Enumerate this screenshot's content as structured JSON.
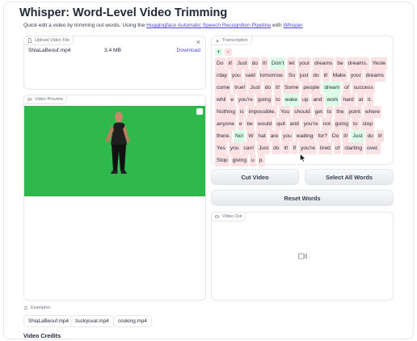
{
  "header": {
    "title": "Whisper: Word-Level Video Trimming",
    "desc_prefix": "Quick edit a video by trimming out words. Using the ",
    "desc_link1": "Huggingface Automatic Speech Recognition Pipeline",
    "desc_mid": " with ",
    "desc_link2": "Whisper"
  },
  "upload": {
    "label": "Upload Video File",
    "filename": "ShiaLaBeouf.mp4",
    "size": "3.4 MB",
    "download": "Download"
  },
  "preview": {
    "label": "Video Preview"
  },
  "transcription": {
    "label": "Transcription",
    "legend_plus": "+",
    "legend_minus": "-",
    "tokens": [
      {
        "t": "Do",
        "g": false
      },
      {
        "t": "it!",
        "g": false
      },
      {
        "t": "Just",
        "g": false
      },
      {
        "t": "do",
        "g": false
      },
      {
        "t": "it!",
        "g": false
      },
      {
        "t": "Don't",
        "g": true
      },
      {
        "t": "let",
        "g": false
      },
      {
        "t": "your",
        "g": false
      },
      {
        "t": "dreams",
        "g": false
      },
      {
        "t": "be",
        "g": false
      },
      {
        "t": "dreams.",
        "g": false
      },
      {
        "t": "Yeste",
        "g": false
      },
      {
        "t": "rday",
        "g": false
      },
      {
        "t": "you",
        "g": false
      },
      {
        "t": "said",
        "g": false
      },
      {
        "t": "tomorrow.",
        "g": false
      },
      {
        "t": "So",
        "g": false
      },
      {
        "t": "just",
        "g": false
      },
      {
        "t": "do",
        "g": false
      },
      {
        "t": "it!",
        "g": false
      },
      {
        "t": "Make",
        "g": false
      },
      {
        "t": "your",
        "g": false
      },
      {
        "t": "dreams",
        "g": false
      },
      {
        "t": "come",
        "g": false
      },
      {
        "t": "true!",
        "g": false
      },
      {
        "t": "Just",
        "g": false
      },
      {
        "t": "do",
        "g": false
      },
      {
        "t": "it!",
        "g": false
      },
      {
        "t": "Some",
        "g": false
      },
      {
        "t": "people",
        "g": false
      },
      {
        "t": "dream",
        "g": true
      },
      {
        "t": "of",
        "g": false
      },
      {
        "t": "success",
        "g": false
      },
      {
        "t": "whil",
        "g": false
      },
      {
        "t": "e",
        "g": false
      },
      {
        "t": "you're",
        "g": false
      },
      {
        "t": "going",
        "g": false
      },
      {
        "t": "to",
        "g": false
      },
      {
        "t": "wake",
        "g": true
      },
      {
        "t": "up",
        "g": false
      },
      {
        "t": "and",
        "g": false
      },
      {
        "t": "work",
        "g": true
      },
      {
        "t": "hard",
        "g": false
      },
      {
        "t": "at",
        "g": false
      },
      {
        "t": "it.",
        "g": false
      },
      {
        "t": "Nothing",
        "g": false
      },
      {
        "t": "is",
        "g": false
      },
      {
        "t": "impossible.",
        "g": false
      },
      {
        "t": "You",
        "g": false
      },
      {
        "t": "should",
        "g": false
      },
      {
        "t": "get",
        "g": false
      },
      {
        "t": "to",
        "g": false
      },
      {
        "t": "the",
        "g": false
      },
      {
        "t": "point",
        "g": false
      },
      {
        "t": "where",
        "g": false
      },
      {
        "t": "anyone",
        "g": false
      },
      {
        "t": "e",
        "g": false
      },
      {
        "t": "be",
        "g": false
      },
      {
        "t": "would",
        "g": false
      },
      {
        "t": "quit",
        "g": false
      },
      {
        "t": "and",
        "g": false
      },
      {
        "t": "you're",
        "g": false
      },
      {
        "t": "not",
        "g": false
      },
      {
        "t": "going",
        "g": false
      },
      {
        "t": "to",
        "g": false
      },
      {
        "t": "stop",
        "g": false
      },
      {
        "t": "there.",
        "g": false
      },
      {
        "t": "No!",
        "g": true
      },
      {
        "t": "W",
        "g": false
      },
      {
        "t": "hat",
        "g": false
      },
      {
        "t": "are",
        "g": false
      },
      {
        "t": "you",
        "g": false
      },
      {
        "t": "waiting",
        "g": false
      },
      {
        "t": "for?",
        "g": false
      },
      {
        "t": "Do",
        "g": false
      },
      {
        "t": "it!",
        "g": false
      },
      {
        "t": "Just",
        "g": true
      },
      {
        "t": "do",
        "g": false
      },
      {
        "t": "it!",
        "g": false
      },
      {
        "t": "Yes",
        "g": false
      },
      {
        "t": "you",
        "g": false
      },
      {
        "t": "can!",
        "g": false
      },
      {
        "t": "Just",
        "g": false
      },
      {
        "t": "do",
        "g": false
      },
      {
        "t": "it!",
        "g": false
      },
      {
        "t": "If",
        "g": false
      },
      {
        "t": "you're",
        "g": false
      },
      {
        "t": "tired",
        "g": false
      },
      {
        "t": "of",
        "g": false
      },
      {
        "t": "starting",
        "g": false
      },
      {
        "t": "over,",
        "g": false
      },
      {
        "t": "Stop",
        "g": false
      },
      {
        "t": "giving",
        "g": false
      },
      {
        "t": "u",
        "g": false
      },
      {
        "t": "p.",
        "g": false
      }
    ]
  },
  "buttons": {
    "cut": "Cut Video",
    "select_all": "Select All Words",
    "reset": "Reset Words"
  },
  "video_out": {
    "label": "Video Out"
  },
  "examples": {
    "label": "Examples",
    "items": [
      "ShiaLaBeouf.mp4",
      "zuckyuval.mp4",
      "cooking.mp4"
    ]
  },
  "credits": {
    "title": "Video Credits"
  },
  "colors": {
    "accent": "#4f46e5",
    "selected": "#fde2e4",
    "kept": "#dcfce7",
    "green_screen": "#2fb84c"
  }
}
